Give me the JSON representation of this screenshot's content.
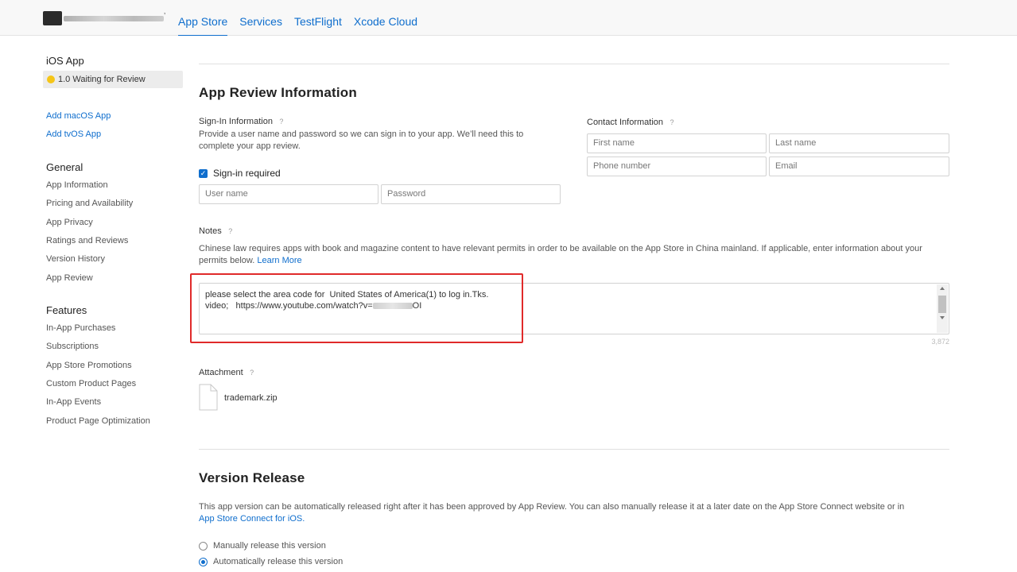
{
  "topbar": {
    "tabs": [
      {
        "label": "App Store"
      },
      {
        "label": "Services"
      },
      {
        "label": "TestFlight"
      },
      {
        "label": "Xcode Cloud"
      }
    ]
  },
  "sidebar": {
    "app_heading": "iOS App",
    "status": "1.0 Waiting for Review",
    "add_links": [
      "Add macOS App",
      "Add tvOS App"
    ],
    "general_heading": "General",
    "general_items": [
      "App Information",
      "Pricing and Availability",
      "App Privacy",
      "Ratings and Reviews",
      "Version History",
      "App Review"
    ],
    "features_heading": "Features",
    "features_items": [
      "In-App Purchases",
      "Subscriptions",
      "App Store Promotions",
      "Custom Product Pages",
      "In-App Events",
      "Product Page Optimization"
    ]
  },
  "review": {
    "title": "App Review Information",
    "signin_label": "Sign-In Information",
    "signin_desc_1": "Provide a user name and password so we can sign in to your app. We’ll need this to",
    "signin_desc_2": "complete your app review.",
    "signin_required": "Sign-in required",
    "username_placeholder": "User name",
    "password_placeholder": "Password",
    "contact_label": "Contact Information",
    "first_name_placeholder": "First name",
    "last_name_placeholder": "Last name",
    "phone_placeholder": "Phone number",
    "email_placeholder": "Email",
    "notes_label": "Notes",
    "notes_desc_1": "Chinese law requires apps with book and magazine content to have relevant permits in order to be available on the App Store in China mainland. If applicable, enter information about your",
    "notes_desc_2": "permits below.",
    "learn_more": "Learn More",
    "notes_line1": "please select the area code for  United States of America(1) to log in.Tks.",
    "notes_line2_start": "video;   https://www.youtube.com/watch?v=",
    "notes_line2_end": "OI",
    "char_count": "3,872",
    "attachment_label": "Attachment",
    "attachment_file": "trademark.zip"
  },
  "release": {
    "title": "Version Release",
    "desc_1": "This app version can be automatically released right after it has been approved by App Review. You can also manually release it at a later date on the App Store Connect website or in",
    "desc_link": "App Store Connect for iOS.",
    "option_manual": "Manually release this version",
    "option_auto": "Automatically release this version",
    "selected": "auto"
  },
  "colors": {
    "accent": "#0f6ecd",
    "status_dot": "#f5c518",
    "highlight_box": "#e02a2a"
  }
}
